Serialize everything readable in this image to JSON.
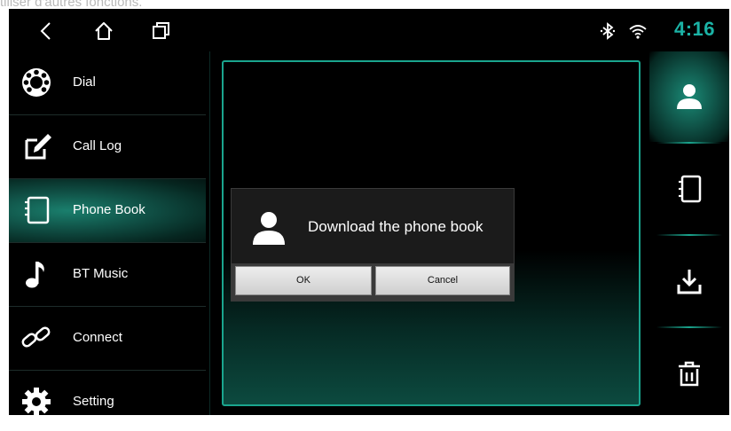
{
  "caption": "tiliser d'autres fonctions.",
  "status_bar": {
    "nav": [
      {
        "icon": "back-icon"
      },
      {
        "icon": "home-icon"
      },
      {
        "icon": "recents-icon"
      }
    ],
    "bluetooth_icon": "bluetooth-icon",
    "wifi_icon": "wifi-icon",
    "time": "4:16",
    "accent_color": "#1bb3a6"
  },
  "sidebar": {
    "items": [
      {
        "label": "Dial",
        "icon": "rotary-phone-icon"
      },
      {
        "label": "Call Log",
        "icon": "edit-log-icon"
      },
      {
        "label": "Phone Book",
        "icon": "phonebook-icon",
        "active": true
      },
      {
        "label": "BT Music",
        "icon": "music-note-icon"
      },
      {
        "label": "Connect",
        "icon": "link-icon"
      },
      {
        "label": "Setting",
        "icon": "gear-icon"
      }
    ]
  },
  "right_bar": {
    "buttons": [
      {
        "icon": "contact-icon",
        "active": true
      },
      {
        "icon": "phonebook-icon"
      },
      {
        "icon": "download-icon"
      },
      {
        "icon": "trash-icon"
      }
    ]
  },
  "dialog": {
    "icon": "contact-icon",
    "message": "Download the phone book",
    "ok_label": "OK",
    "cancel_label": "Cancel"
  }
}
